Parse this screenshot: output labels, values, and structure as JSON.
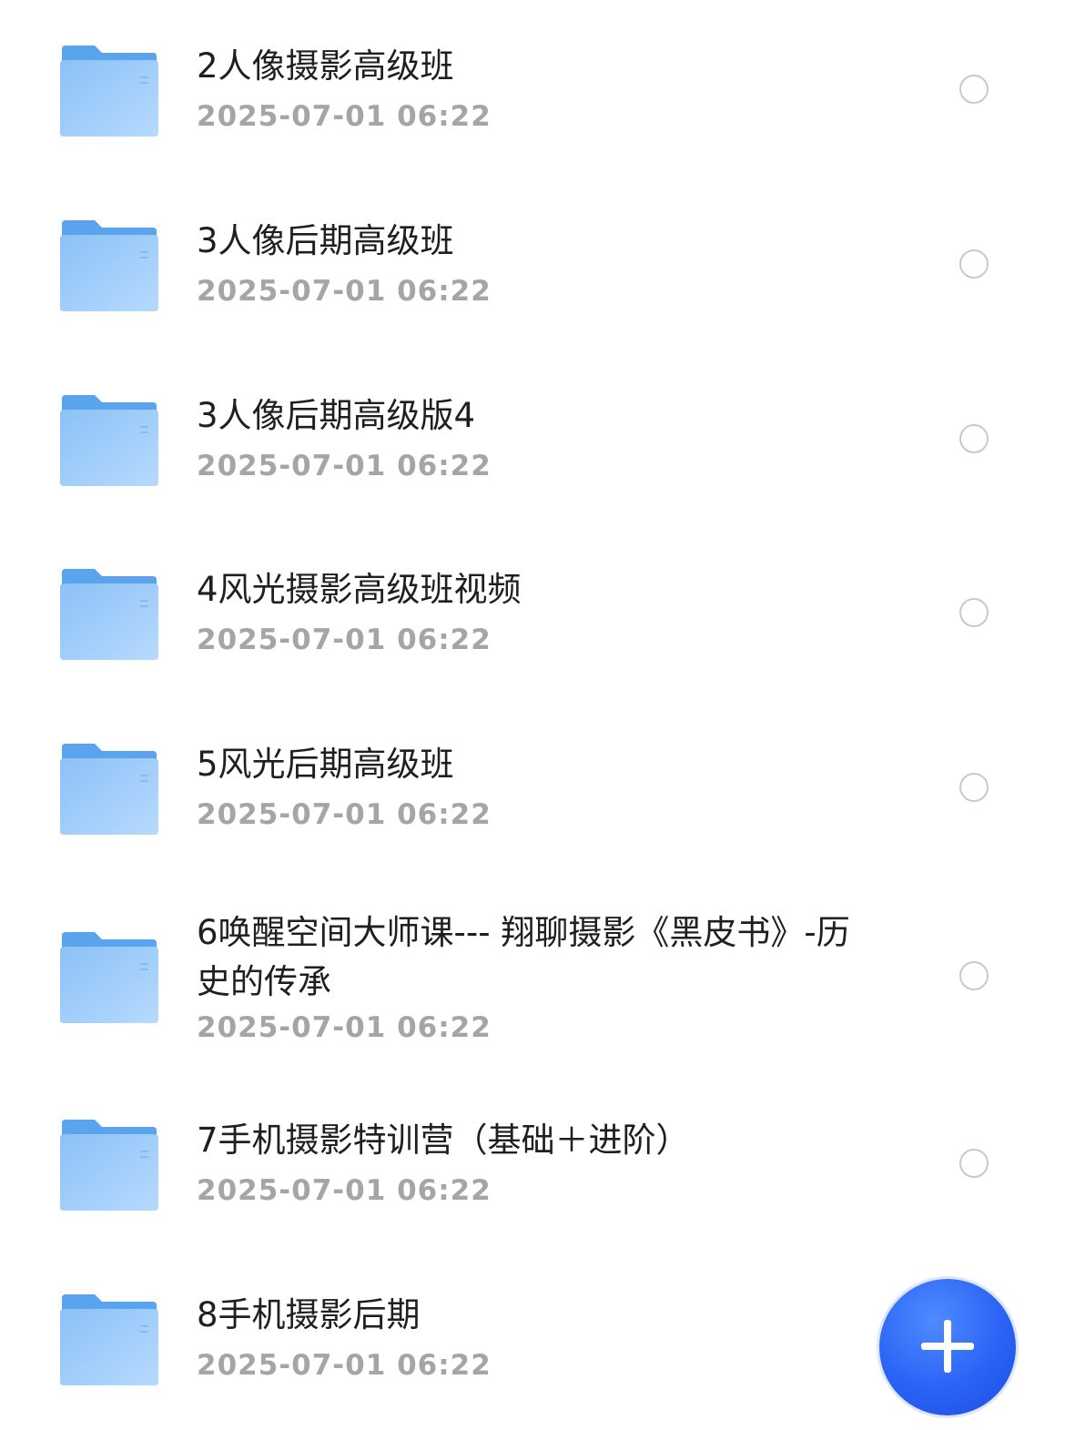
{
  "files": [
    {
      "name": "2人像摄影高级班",
      "date": "2025-07-01 06:22"
    },
    {
      "name": "3人像后期高级班",
      "date": "2025-07-01 06:22"
    },
    {
      "name": "3人像后期高级版4",
      "date": "2025-07-01 06:22"
    },
    {
      "name": "4风光摄影高级班视频",
      "date": "2025-07-01 06:22"
    },
    {
      "name": "5风光后期高级班",
      "date": "2025-07-01 06:22"
    },
    {
      "name": "6唤醒空间大师课--- 翔聊摄影《黑皮书》-历史的传承",
      "date": "2025-07-01 06:22"
    },
    {
      "name": "7手机摄影特训营（基础＋进阶）",
      "date": "2025-07-01 06:22"
    },
    {
      "name": "8手机摄影后期",
      "date": "2025-07-01 06:22"
    }
  ],
  "colors": {
    "folder_back": "#5aa4ee",
    "folder_front": "#a9d2fb",
    "fab": "#2a63f5"
  }
}
